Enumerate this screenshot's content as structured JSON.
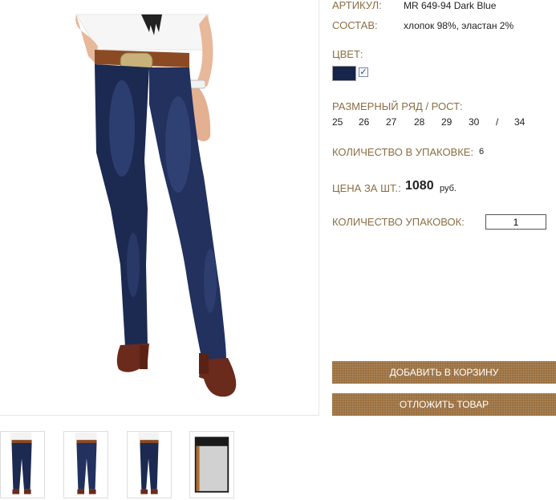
{
  "product": {
    "article_label": "АРТИКУЛ:",
    "article_value": "MR 649-94 Dark Blue",
    "composition_label": "СОСТАВ:",
    "composition_value": "хлопок 98%, эластан 2%",
    "color_label": "ЦВЕТ:",
    "color_swatch": "#17244c",
    "size_label": "РАЗМЕРНЫЙ РЯД / РОСТ:",
    "sizes": [
      "25",
      "26",
      "27",
      "28",
      "29",
      "30",
      "/",
      "34"
    ],
    "pack_qty_label": "КОЛИЧЕСТВО В УПАКОВКЕ:",
    "pack_qty_value": "6",
    "price_label": "ЦЕНА ЗА ШТ.:",
    "price_value": "1080",
    "price_currency": "руб.",
    "packs_label": "КОЛИЧЕСТВО УПАКОВОК:",
    "packs_value": "1"
  },
  "buttons": {
    "add_to_cart": "ДОБАВИТЬ В КОРЗИНУ",
    "postpone": "ОТЛОЖИТЬ ТОВАР"
  },
  "colors": {
    "label_brown": "#8b6e45",
    "button_brown": "#9a6f3e",
    "denim": "#1c2a52"
  }
}
